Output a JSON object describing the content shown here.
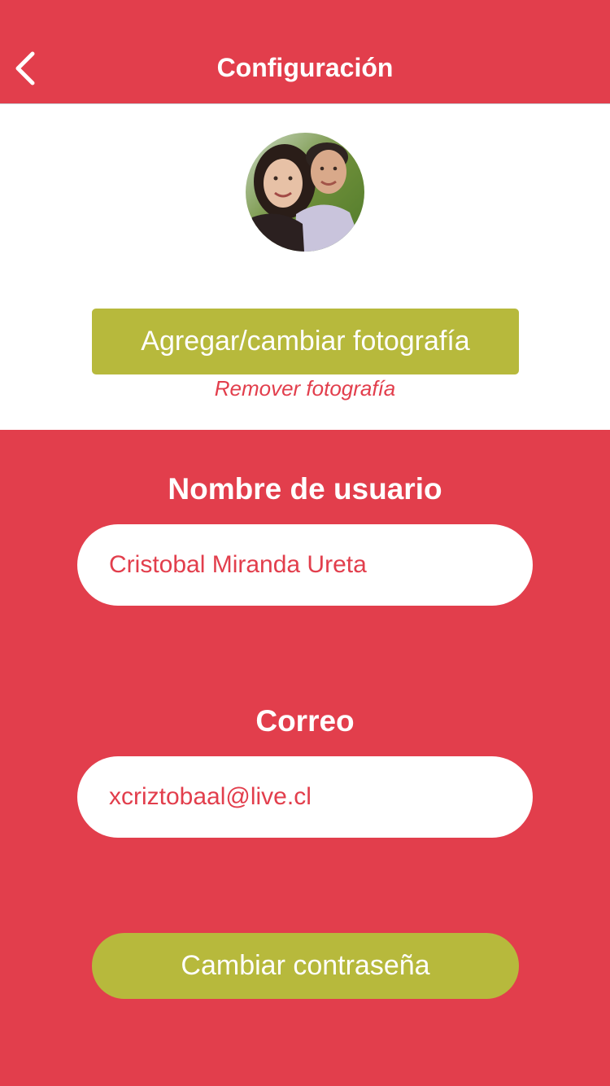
{
  "header": {
    "title": "Configuración",
    "back_icon": "chevron-left-icon"
  },
  "profile": {
    "avatar_description": "profile photo",
    "add_photo_label": "Agregar/cambiar fotografía",
    "remove_photo_label": "Remover fotografía"
  },
  "form": {
    "username_label": "Nombre de usuario",
    "username_value": "Cristobal Miranda Ureta",
    "email_label": "Correo",
    "email_value": "xcriztobaal@live.cl",
    "change_password_label": "Cambiar contraseña"
  },
  "colors": {
    "primary": "#e23e4c",
    "accent": "#b7b93c",
    "white": "#ffffff"
  }
}
